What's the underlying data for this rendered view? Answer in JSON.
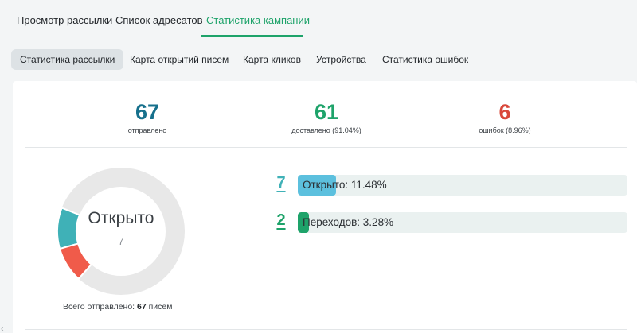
{
  "top_tabs": [
    {
      "label": "Просмотр рассылки"
    },
    {
      "label": "Список адресатов"
    },
    {
      "label": "Статистика кампании"
    }
  ],
  "sub_tabs": [
    {
      "label": "Статистика рассылки"
    },
    {
      "label": "Карта открытий писем"
    },
    {
      "label": "Карта кликов"
    },
    {
      "label": "Устройства"
    },
    {
      "label": "Статистика ошибок"
    }
  ],
  "summary": {
    "sent": {
      "value": "67",
      "label": "отправлено",
      "color": "#16708c"
    },
    "delivered": {
      "value": "61",
      "label": "доставлено (91.04%)",
      "color": "#1ea36a"
    },
    "errors": {
      "value": "6",
      "label": "ошибок (8.96%)",
      "color": "#d9483b"
    }
  },
  "donut": {
    "center_label": "Открыто",
    "center_value": "7",
    "total_prefix": "Всего отправлено:",
    "total_count": "67",
    "total_suffix": "писем",
    "segments": [
      {
        "name": "opened",
        "value": 7,
        "color": "#3fb1b7"
      },
      {
        "name": "errors",
        "value": 6,
        "color": "#f05b4a"
      },
      {
        "name": "rest",
        "value": 54,
        "color": "#e8e8e8"
      }
    ]
  },
  "metrics": [
    {
      "count": "7",
      "label": "Открыто: 11.48%",
      "fraction": 0.1148,
      "count_color": "#3fb1b7",
      "fill_color": "#5cc0de"
    },
    {
      "count": "2",
      "label": "Переходов: 3.28%",
      "fraction": 0.0328,
      "count_color": "#1ea36a",
      "fill_color": "#1ea36a"
    }
  ],
  "scroll_left_glyph": "‹"
}
